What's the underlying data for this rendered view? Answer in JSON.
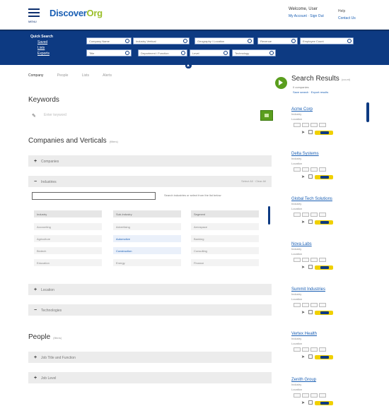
{
  "header": {
    "menu_label": "MENU",
    "logo_main": "Discover",
    "logo_suffix": "Org",
    "user_name": "Welcome, User",
    "user_links": "My Account · Sign Out",
    "help_top": "Help",
    "help_links": "Contact Us"
  },
  "nav": {
    "heading": "Quick Search",
    "links": [
      "Saved",
      "Lists",
      "Exports"
    ]
  },
  "filters_row1": [
    "Company Name",
    "Industry Vertical",
    "Geography / Location",
    "Revenue",
    "Employee Count"
  ],
  "filters_row2": [
    "Title",
    "Department / Function",
    "Level",
    "Technology"
  ],
  "tabs": [
    "Company",
    "People",
    "Lists",
    "Alerts"
  ],
  "keywords": {
    "title": "Keywords",
    "placeholder": "Enter keyword"
  },
  "companies": {
    "title": "Companies and Verticals",
    "count": "(filters)",
    "accordion": [
      {
        "sign": "+",
        "label": "Companies",
        "right": ""
      },
      {
        "sign": "−",
        "label": "Industries",
        "right": "Select All · Clear All"
      }
    ],
    "filter_placeholder": "",
    "filter_hint": "Search industries or select from the list below",
    "grid_headers": [
      "Industry",
      "Sub-Industry",
      "Segment"
    ],
    "grid_rows": [
      [
        "Accounting",
        "Advertising",
        "Aerospace"
      ],
      [
        "Agriculture",
        "Automotive",
        "Banking"
      ],
      [
        "Biotech",
        "Construction",
        "Consulting"
      ],
      [
        "Education",
        "Energy",
        "Finance"
      ]
    ],
    "more_accordion": [
      {
        "sign": "+",
        "label": "Location"
      },
      {
        "sign": "−",
        "label": "Technologies"
      }
    ]
  },
  "people": {
    "title": "People",
    "count": "(filters)",
    "accordion": [
      {
        "sign": "+",
        "label": "Job Title and Function"
      },
      {
        "sign": "+",
        "label": "Job Level"
      }
    ]
  },
  "results": {
    "title": "Search Results",
    "title_small": "(count)",
    "sub_line1": "0 companies",
    "sub_line2": "Save search · Export results",
    "items": [
      {
        "name": "Acme Corp",
        "meta1": "Industry",
        "meta2": "Location"
      },
      {
        "name": "Delta Systems",
        "meta1": "Industry",
        "meta2": "Location"
      },
      {
        "name": "Global Tech Solutions",
        "meta1": "Industry",
        "meta2": "Location"
      },
      {
        "name": "Nova Labs",
        "meta1": "Industry",
        "meta2": "Location"
      },
      {
        "name": "Summit Industries",
        "meta1": "Industry",
        "meta2": "Location"
      },
      {
        "name": "Vertex Health",
        "meta1": "Industry",
        "meta2": "Location"
      },
      {
        "name": "Zenith Group",
        "meta1": "Industry",
        "meta2": "Location"
      }
    ]
  },
  "colors": {
    "nav_blue": "#0d3a82",
    "link_blue": "#1a5fb4",
    "accent_green": "#5a9e1e",
    "accent_yellow": "#f0d000"
  }
}
